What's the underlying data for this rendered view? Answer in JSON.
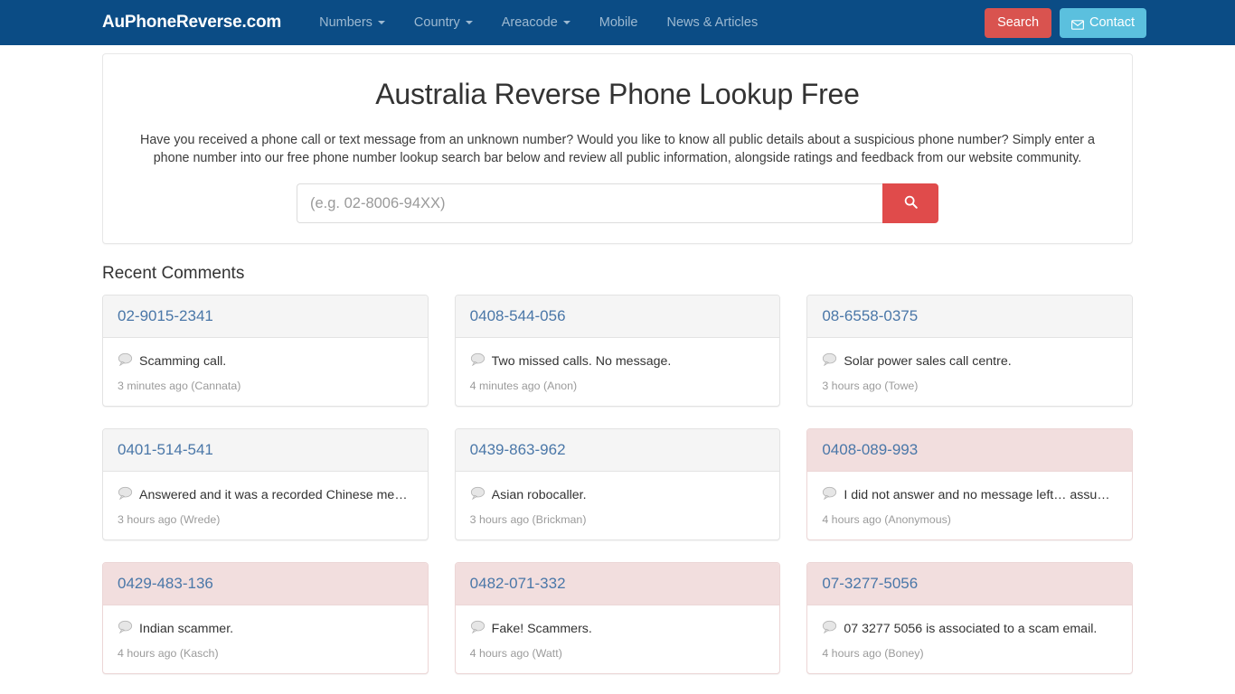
{
  "navbar": {
    "brand": "AuPhoneReverse.com",
    "links": [
      {
        "label": "Numbers",
        "caret": true
      },
      {
        "label": "Country",
        "caret": true
      },
      {
        "label": "Areacode",
        "caret": true
      },
      {
        "label": "Mobile",
        "caret": false
      },
      {
        "label": "News & Articles",
        "caret": false
      }
    ],
    "search_button": "Search",
    "contact_button": "Contact",
    "contact_icon": "envelope-icon",
    "colors": {
      "background": "#0b4c85",
      "link": "#9db9d1",
      "search_button": "#d9534f",
      "contact_button": "#5bc0de"
    }
  },
  "hero": {
    "title": "Australia Reverse Phone Lookup Free",
    "description": "Have you received a phone call or text message from an unknown number? Would you like to know all public details about a suspicious phone number? Simply enter a phone number into our free phone number lookup search bar below and review all public information, alongside ratings and feedback from our website community.",
    "search_placeholder": "(e.g. 02-8006-94XX)",
    "search_value": "",
    "search_icon": "magnifier-icon",
    "search_button_color": "#e04b4b"
  },
  "recent_comments": {
    "heading": "Recent Comments",
    "comment_icon": "speech-bubble-icon",
    "cards": [
      {
        "number": "02-9015-2341",
        "comment": "Scamming call.",
        "meta": "3 minutes ago (Cannata)",
        "danger": false
      },
      {
        "number": "0408-544-056",
        "comment": "Two missed calls. No message.",
        "meta": "4 minutes ago (Anon)",
        "danger": false
      },
      {
        "number": "08-6558-0375",
        "comment": "Solar power sales call centre.",
        "meta": "3 hours ago (Towe)",
        "danger": false
      },
      {
        "number": "0401-514-541",
        "comment": "Answered and it was a recorded Chinese mes…",
        "meta": "3 hours ago (Wrede)",
        "danger": false
      },
      {
        "number": "0439-863-962",
        "comment": "Asian robocaller.",
        "meta": "3 hours ago (Brickman)",
        "danger": false
      },
      {
        "number": "0408-089-993",
        "comment": "I did not answer and no message left… assum…",
        "meta": "4 hours ago (Anonymous)",
        "danger": true
      },
      {
        "number": "0429-483-136",
        "comment": "Indian scammer.",
        "meta": "4 hours ago (Kasch)",
        "danger": true
      },
      {
        "number": "0482-071-332",
        "comment": "Fake! Scammers.",
        "meta": "4 hours ago (Watt)",
        "danger": true
      },
      {
        "number": "07-3277-5056",
        "comment": "07 3277 5056 is associated to a scam email.",
        "meta": "4 hours ago (Boney)",
        "danger": true
      }
    ]
  }
}
